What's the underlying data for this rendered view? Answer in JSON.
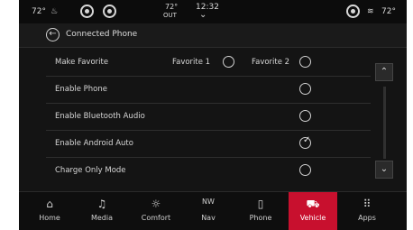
{
  "status_bar": {
    "left_temp": "72°",
    "outside_temp": "72°",
    "outside_label": "OUT",
    "time": "12:32",
    "right_temp": "72°"
  },
  "header": {
    "title": "Connected Phone"
  },
  "settings": {
    "make_favorite": {
      "label": "Make Favorite",
      "fav1": "Favorite 1",
      "fav2": "Favorite 2"
    },
    "rows": [
      {
        "label": "Enable Phone",
        "checked": false
      },
      {
        "label": "Enable Bluetooth Audio",
        "checked": false
      },
      {
        "label": "Enable Android Auto",
        "checked": true
      },
      {
        "label": "Charge Only Mode",
        "checked": false
      }
    ]
  },
  "nav": {
    "items": [
      {
        "label": "Home",
        "icon": "home-icon",
        "glyph": "⌂"
      },
      {
        "label": "Media",
        "icon": "music-icon",
        "glyph": "♫"
      },
      {
        "label": "Comfort",
        "icon": "comfort-icon",
        "glyph": "☼"
      },
      {
        "label": "Nav",
        "icon": "compass-icon",
        "glyph": "NW"
      },
      {
        "label": "Phone",
        "icon": "phone-icon",
        "glyph": "▯"
      },
      {
        "label": "Vehicle",
        "icon": "car-icon",
        "glyph": "⛟"
      },
      {
        "label": "Apps",
        "icon": "apps-icon",
        "glyph": "⠿"
      }
    ]
  },
  "colors": {
    "active_tab": "#c8102e",
    "background": "#141414"
  }
}
